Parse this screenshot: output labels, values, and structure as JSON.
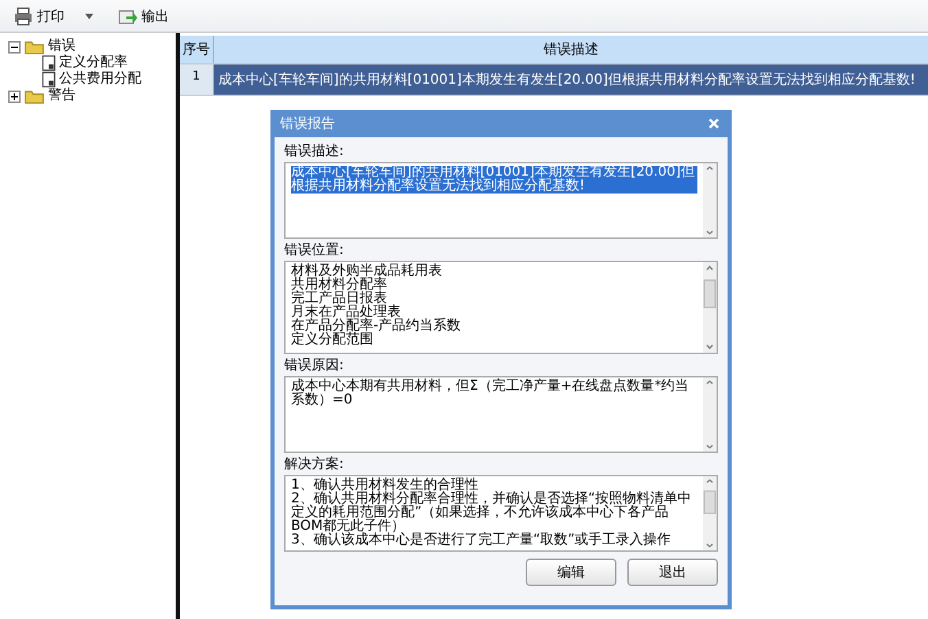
{
  "toolbar": {
    "items": [
      {
        "label": "打印",
        "kind": "dropdown"
      },
      {
        "label": "输出",
        "kind": "plain"
      }
    ]
  },
  "tree": {
    "items": [
      {
        "label": "错误",
        "expanded": true,
        "children": [
          {
            "label": "定义分配率"
          },
          {
            "label": "公共费用分配"
          }
        ]
      },
      {
        "label": "警告",
        "expanded": false
      }
    ]
  },
  "table": {
    "columns": [
      "序号",
      "错误描述"
    ],
    "rows": [
      {
        "cells": [
          "1",
          "成本中心[车轮车间]的共用材料[01001]本期发生有发生[20.00]但根据共用材料分配率设置无法找到相应分配基数!"
        ],
        "selected": true
      }
    ]
  },
  "dialog": {
    "title": "错误报告",
    "fields": [
      {
        "label": "错误描述:",
        "selected": true,
        "lines": [
          "成本中心[车轮车间]的共用材料[01001]本期发生有发生[20.00]但根据共用材料分配率设置无法找到相应分配基数!"
        ]
      },
      {
        "label": "错误位置:",
        "selected": false,
        "lines": [
          "材料及外购半成品耗用表",
          "共用材料分配率",
          "完工产品日报表",
          "月末在产品处理表",
          "在产品分配率-产品约当系数",
          "定义分配范围"
        ]
      },
      {
        "label": "错误原因:",
        "selected": false,
        "lines": [
          "成本中心本期有共用材料，但Σ（完工净产量+在线盘点数量*约当系数）=0"
        ]
      },
      {
        "label": "解决方案:",
        "selected": false,
        "lines": [
          "1、确认共用材料发生的合理性",
          "2、确认共用材料分配率合理性，并确认是否选择“按照物料清单中定义的耗用范围分配”（如果选择，不允许该成本中心下各产品BOM都无此子件）",
          "3、确认该成本中心是否进行了完工产量“取数”或手工录入操作"
        ]
      }
    ],
    "buttons": [
      "编辑",
      "退出"
    ]
  }
}
